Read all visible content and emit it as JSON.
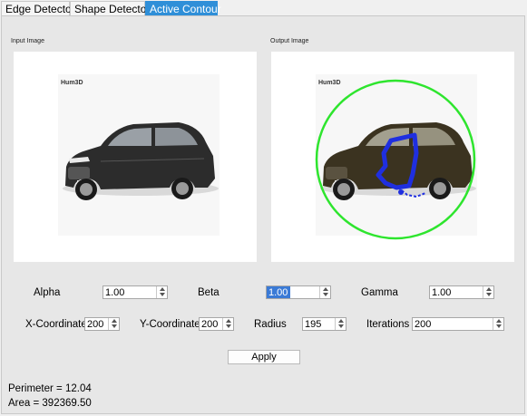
{
  "tabs": [
    {
      "label": "Edge Detector",
      "active": false
    },
    {
      "label": "Shape Detector",
      "active": false
    },
    {
      "label": "Active Contour",
      "active": true
    }
  ],
  "input_panel": {
    "caption": "Input Image",
    "watermark": "Hum3D"
  },
  "output_panel": {
    "caption": "Output Image",
    "watermark": "Hum3D",
    "contour_color": "#2ee52e",
    "snake_color": "#1f2fe0"
  },
  "params": {
    "alpha": {
      "label": "Alpha",
      "value": "1.00"
    },
    "beta": {
      "label": "Beta",
      "value": "1.00"
    },
    "gamma": {
      "label": "Gamma",
      "value": "1.00"
    },
    "x_coordinate": {
      "label": "X-Coordinate",
      "value": "200"
    },
    "y_coordinate": {
      "label": "Y-Coordinate",
      "value": "200"
    },
    "radius": {
      "label": "Radius",
      "value": "195"
    },
    "iterations": {
      "label": "Iterations",
      "value": "200"
    }
  },
  "apply_label": "Apply",
  "results": {
    "perimeter": "Perimeter = 12.04",
    "area": "Area = 392369.50"
  },
  "colors": {
    "tab_active": "#2f8fd8",
    "selection": "#3a7ad6"
  }
}
